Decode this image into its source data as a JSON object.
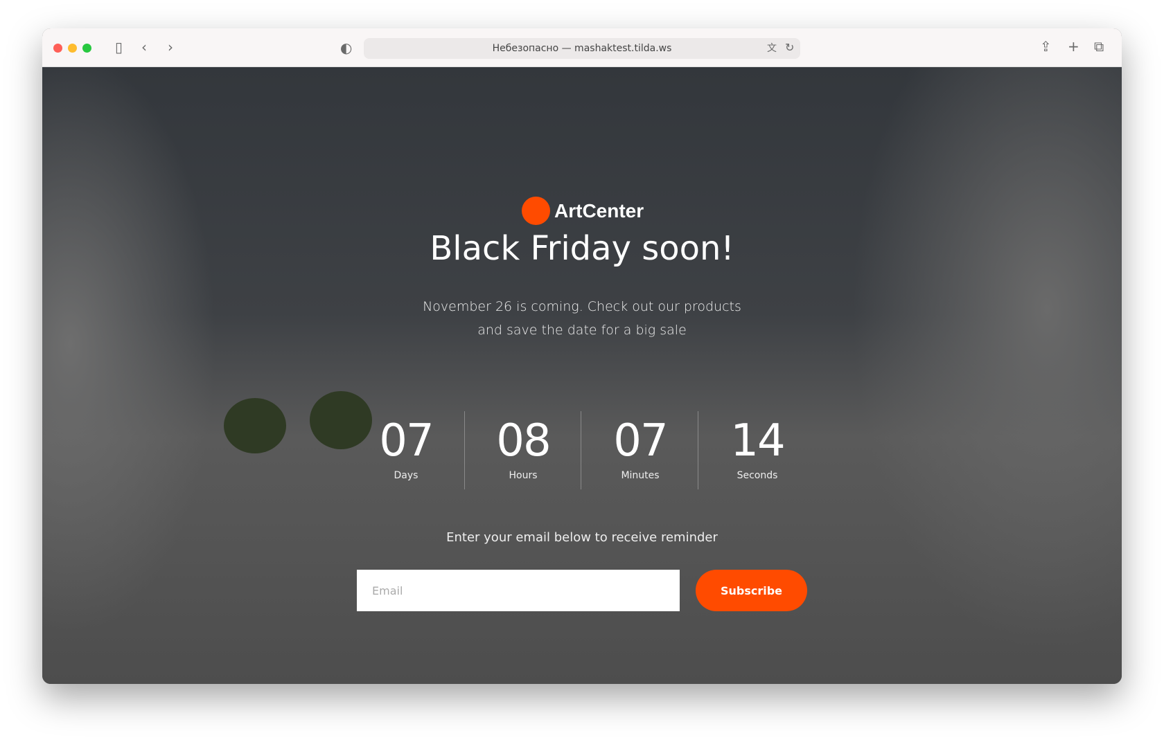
{
  "browser": {
    "url": "Небезопасно — mashaktest.tilda.ws",
    "icons": [
      "sidebar-icon",
      "back-icon",
      "forward-icon",
      "shield-icon",
      "translate-icon",
      "reload-icon",
      "share-icon",
      "new-tab-icon",
      "tabs-icon"
    ]
  },
  "logo": {
    "name": "ArtCenter",
    "color": "#ff4b00"
  },
  "hero": {
    "title": "Black Friday soon!",
    "subtitle_line1": "November 26 is coming. Check out our products",
    "subtitle_line2": "and save the date for a big sale"
  },
  "countdown": [
    {
      "value": "07",
      "label": "Days"
    },
    {
      "value": "08",
      "label": "Hours"
    },
    {
      "value": "07",
      "label": "Minutes"
    },
    {
      "value": "14",
      "label": "Seconds"
    }
  ],
  "form": {
    "prompt": "Enter your email below to receive reminder",
    "email_placeholder": "Email",
    "email_value": "",
    "submit_label": "Subscribe",
    "accent": "#ff4b00"
  }
}
